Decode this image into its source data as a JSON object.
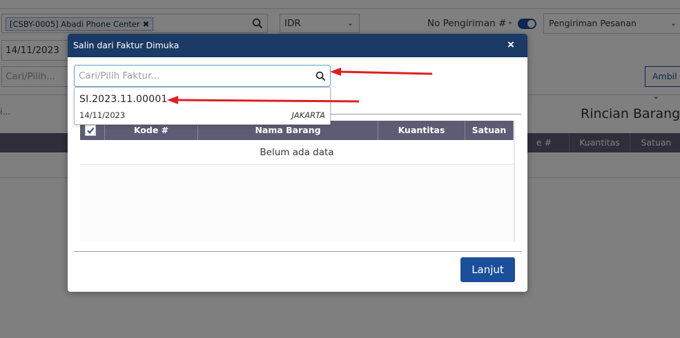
{
  "background": {
    "customer_tag": "[CSBY-0005] Abadi Phone Center",
    "customer_tag_remove": "✖",
    "currency": "IDR",
    "no_pengiriman_label": "No Pengiriman #",
    "required_mark": "*",
    "pengiriman_type": "Pengiriman Pesanan",
    "date": "14/11/2023",
    "cari_placeholder": "Cari/Pilih...",
    "ambil_label": "Ambil",
    "cari_small": "i...",
    "rincian_title": "Rincian Barang",
    "table_headers": [
      "e #",
      "Kuantitas",
      "Satuan"
    ]
  },
  "modal": {
    "title": "Salin dari Faktur Dimuka",
    "close_icon": "×",
    "search_placeholder": "Cari/Pilih Faktur...",
    "grid_headers": {
      "kode": "Kode #",
      "nama": "Nama Barang",
      "kuantitas": "Kuantitas",
      "satuan": "Satuan"
    },
    "empty_text": "Belum ada data",
    "lanjut_label": "Lanjut"
  },
  "dropdown": {
    "items": [
      {
        "number": "SI.2023.11.00001",
        "date": "14/11/2023",
        "city": "JAKARTA"
      }
    ]
  },
  "colors": {
    "header_navy": "#1b3a66",
    "primary_button": "#1c4f9a",
    "table_header": "#5e5c74",
    "annotation_red": "#e01e1e"
  }
}
